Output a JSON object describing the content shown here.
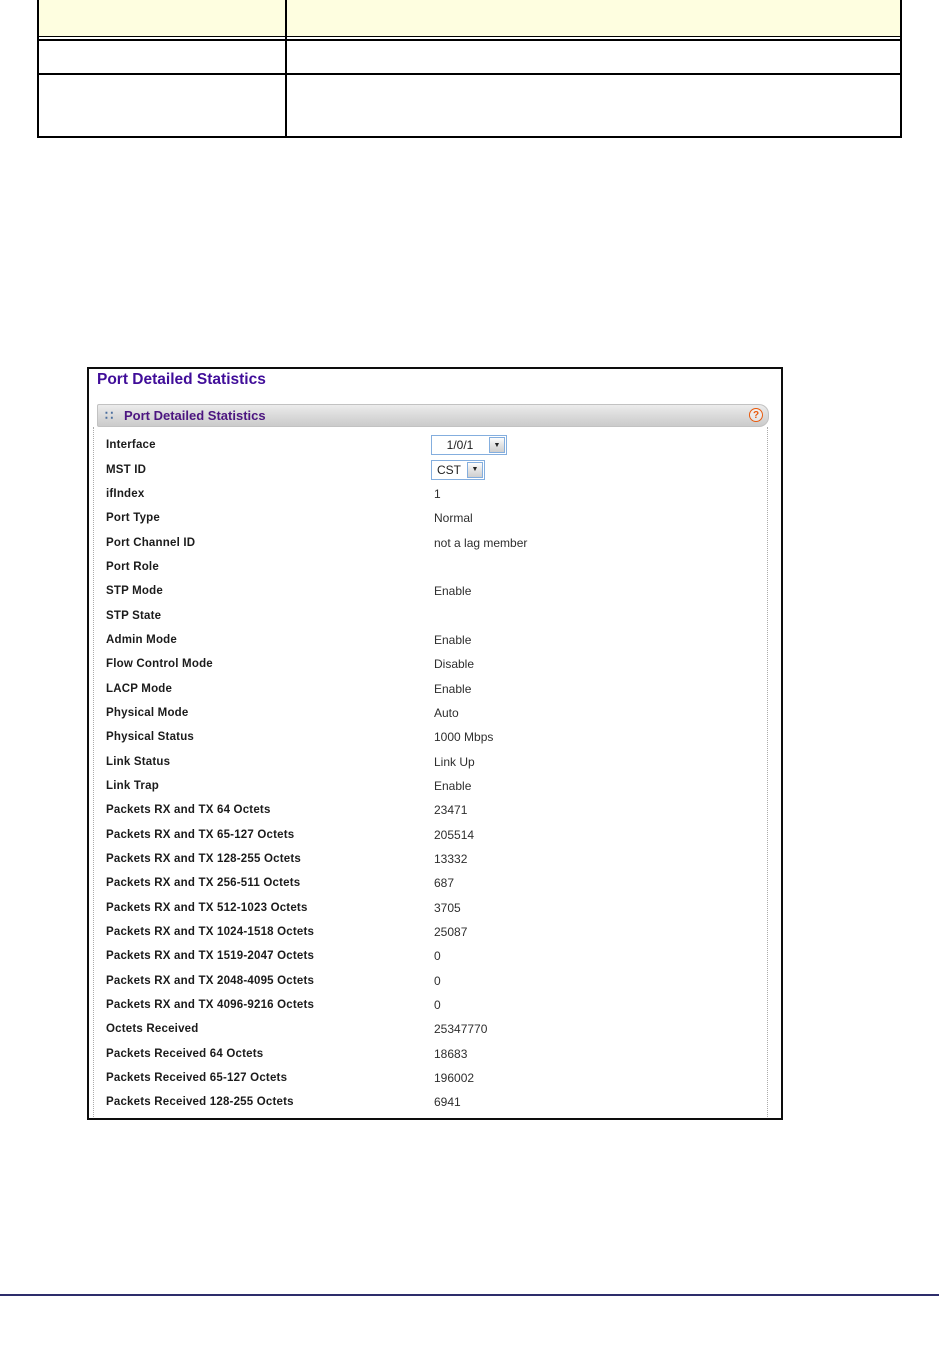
{
  "document": {
    "table": {
      "header_bg": "#fefee0",
      "header": [
        "",
        ""
      ],
      "rows": [
        [
          "",
          ""
        ],
        [
          "",
          ""
        ]
      ]
    },
    "footer_rule_color": "#2d2d6b"
  },
  "app": {
    "page_title": "Port Detailed Statistics",
    "panel": {
      "title": "Port Detailed Statistics",
      "accent_purple": "#4c1580",
      "help_orange": "#e8590c"
    },
    "icons": {
      "drag": "∷",
      "help": "?",
      "chevron_down": "▼"
    },
    "fields": [
      {
        "label": "Interface",
        "value": "1/0/1",
        "widget": "select"
      },
      {
        "label": "MST ID",
        "value": "CST",
        "widget": "select"
      },
      {
        "label": "ifIndex",
        "value": "1",
        "widget": "text"
      },
      {
        "label": "Port Type",
        "value": "Normal",
        "widget": "text"
      },
      {
        "label": "Port Channel ID",
        "value": "not a lag member",
        "widget": "text"
      },
      {
        "label": "Port Role",
        "value": "",
        "widget": "text"
      },
      {
        "label": "STP Mode",
        "value": "Enable",
        "widget": "text"
      },
      {
        "label": "STP State",
        "value": "",
        "widget": "text"
      },
      {
        "label": "Admin Mode",
        "value": "Enable",
        "widget": "text"
      },
      {
        "label": "Flow Control Mode",
        "value": "Disable",
        "widget": "text"
      },
      {
        "label": "LACP Mode",
        "value": "Enable",
        "widget": "text"
      },
      {
        "label": "Physical Mode",
        "value": "Auto",
        "widget": "text"
      },
      {
        "label": "Physical Status",
        "value": "1000 Mbps",
        "widget": "text"
      },
      {
        "label": "Link Status",
        "value": "Link Up",
        "widget": "text"
      },
      {
        "label": "Link Trap",
        "value": "Enable",
        "widget": "text"
      },
      {
        "label": "Packets RX and TX 64 Octets",
        "value": "23471",
        "widget": "text"
      },
      {
        "label": "Packets RX and TX 65-127 Octets",
        "value": "205514",
        "widget": "text"
      },
      {
        "label": "Packets RX and TX 128-255 Octets",
        "value": "13332",
        "widget": "text"
      },
      {
        "label": "Packets RX and TX 256-511 Octets",
        "value": "687",
        "widget": "text"
      },
      {
        "label": "Packets RX and TX 512-1023 Octets",
        "value": "3705",
        "widget": "text"
      },
      {
        "label": "Packets RX and TX 1024-1518 Octets",
        "value": "25087",
        "widget": "text"
      },
      {
        "label": "Packets RX and TX 1519-2047 Octets",
        "value": "0",
        "widget": "text"
      },
      {
        "label": "Packets RX and TX 2048-4095 Octets",
        "value": "0",
        "widget": "text"
      },
      {
        "label": "Packets RX and TX 4096-9216 Octets",
        "value": "0",
        "widget": "text"
      },
      {
        "label": "Octets Received",
        "value": "25347770",
        "widget": "text"
      },
      {
        "label": "Packets Received 64 Octets",
        "value": "18683",
        "widget": "text"
      },
      {
        "label": "Packets Received 65-127 Octets",
        "value": "196002",
        "widget": "text"
      },
      {
        "label": "Packets Received 128-255 Octets",
        "value": "6941",
        "widget": "text"
      }
    ]
  }
}
